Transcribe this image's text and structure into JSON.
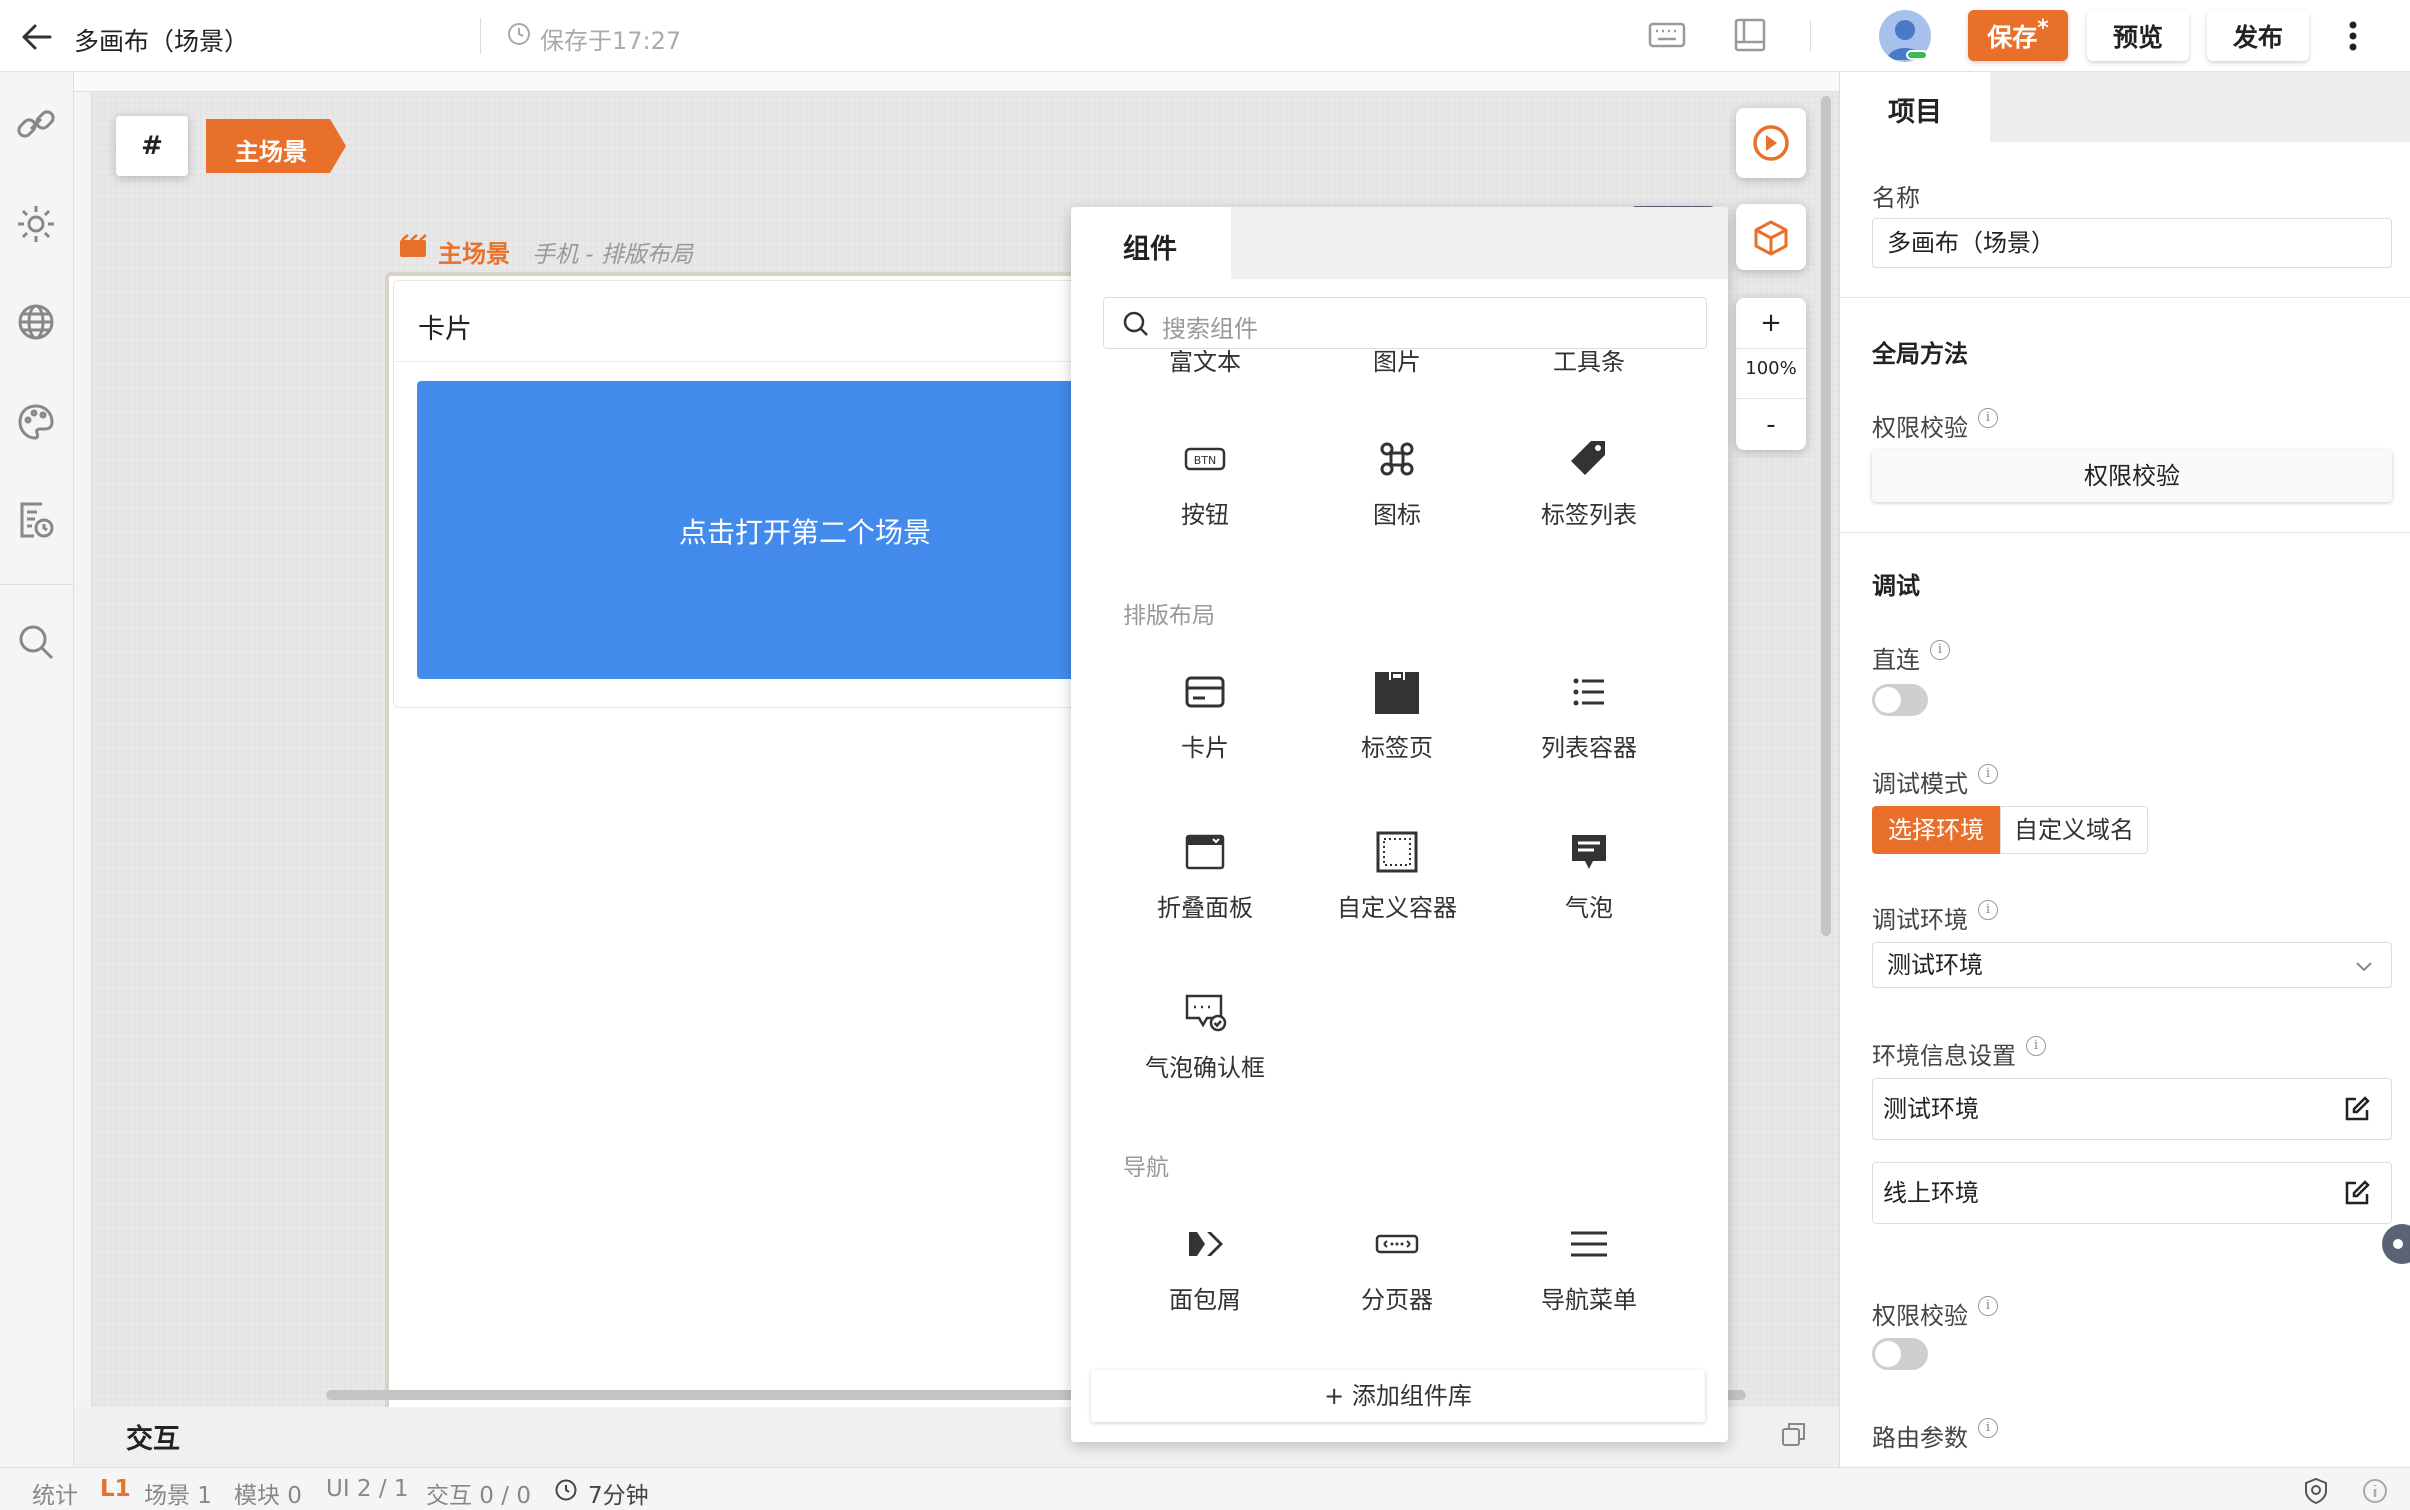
{
  "topbar": {
    "title": "多画布（场景）",
    "save_status": "保存于17:27",
    "save_label": "保存",
    "save_dirty_mark": "*",
    "preview_label": "预览",
    "publish_label": "发布"
  },
  "canvas": {
    "scene_hash": "#",
    "scene_tab": "主场景",
    "scene_title": "主场景",
    "scene_subtitle": "手机 - 排版布局",
    "card_title": "卡片",
    "card_button": "点击打开第二个场景",
    "zoom": "100%",
    "zoom_in": "+",
    "zoom_out": "-",
    "tooltip": "组件",
    "interaction_label": "交互"
  },
  "components_panel": {
    "tab": "组件",
    "search_placeholder": "搜索组件",
    "partial_items": [
      "富文本",
      "图片",
      "工具条"
    ],
    "sections": [
      {
        "title": "",
        "items": [
          {
            "label": "按钮",
            "icon": "button-icon"
          },
          {
            "label": "图标",
            "icon": "command-icon"
          },
          {
            "label": "标签列表",
            "icon": "tag-icon"
          }
        ]
      },
      {
        "title": "排版布局",
        "items": [
          {
            "label": "卡片",
            "icon": "card-icon"
          },
          {
            "label": "标签页",
            "icon": "tabs-icon"
          },
          {
            "label": "列表容器",
            "icon": "list-icon"
          },
          {
            "label": "折叠面板",
            "icon": "collapse-icon"
          },
          {
            "label": "自定义容器",
            "icon": "container-icon"
          },
          {
            "label": "气泡",
            "icon": "bubble-icon"
          },
          {
            "label": "气泡确认框",
            "icon": "bubble-confirm-icon"
          }
        ]
      },
      {
        "title": "导航",
        "items": [
          {
            "label": "面包屑",
            "icon": "breadcrumb-icon"
          },
          {
            "label": "分页器",
            "icon": "pagination-icon"
          },
          {
            "label": "导航菜单",
            "icon": "menu-icon"
          }
        ]
      }
    ],
    "add_library": "+ 添加组件库"
  },
  "right_panel": {
    "tab": "项目",
    "name_label": "名称",
    "name_value": "多画布（场景）",
    "global_methods": "全局方法",
    "permission_check_label": "权限校验",
    "permission_check_button": "权限校验",
    "debug_heading": "调试",
    "direct_label": "直连",
    "debug_mode_label": "调试模式",
    "debug_mode_options": [
      "选择环境",
      "自定义域名"
    ],
    "debug_env_label": "调试环境",
    "debug_env_value": "测试环境",
    "env_settings_label": "环境信息设置",
    "env_items": [
      "测试环境",
      "线上环境"
    ],
    "permission_check_label2": "权限校验",
    "route_params_label": "路由参数"
  },
  "statusbar": {
    "stats": "统计",
    "level": "L1",
    "scenes": "场景 1",
    "modules": "模块 0",
    "ui": "UI 2 / 1",
    "interactions": "交互 0 / 0",
    "time": "7分钟"
  },
  "colors": {
    "accent": "#e8702a",
    "primary_blue": "#428bec",
    "tooltip_bg": "#5a6374"
  }
}
